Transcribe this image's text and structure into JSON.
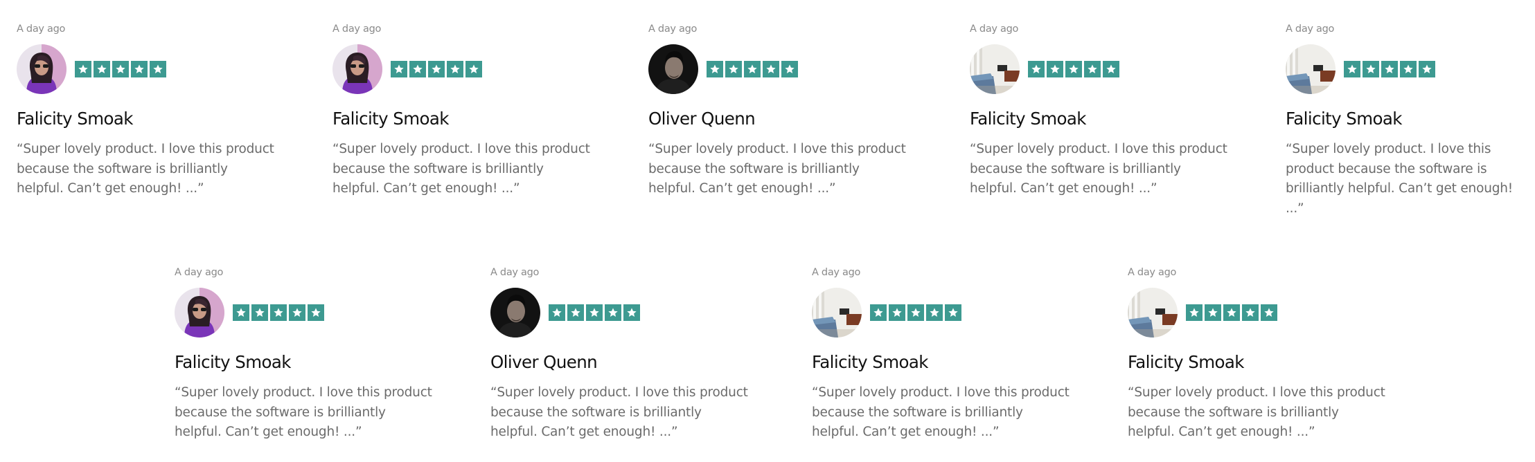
{
  "reviews": [
    {
      "time": "A day ago",
      "name": "Falicity Smoak",
      "avatar": "woman-purple-avatar",
      "rating": 5,
      "quote": "“Super lovely product. I love this product because the software is brilliantly helpful. Can’t get enough! ...”"
    },
    {
      "time": "A day ago",
      "name": "Falicity Smoak",
      "avatar": "woman-purple-avatar",
      "rating": 5,
      "quote": "“Super lovely product. I love this product because the software is brilliantly helpful. Can’t get enough! ...”"
    },
    {
      "time": "A day ago",
      "name": "Oliver Quenn",
      "avatar": "man-dark-avatar",
      "rating": 5,
      "quote": "“Super lovely product. I love this product because the software is brilliantly helpful. Can’t get enough! ...”"
    },
    {
      "time": "A day ago",
      "name": "Falicity Smoak",
      "avatar": "room-interior-avatar",
      "rating": 5,
      "quote": "“Super lovely product. I love this product because the software is brilliantly helpful. Can’t get enough! ...”"
    },
    {
      "time": "A day ago",
      "name": "Falicity Smoak",
      "avatar": "room-interior-avatar",
      "rating": 5,
      "quote": "“Super lovely product. I love this product because the software is brilliantly helpful. Can’t get enough! ...”"
    },
    {
      "time": "A day ago",
      "name": "Falicity Smoak",
      "avatar": "woman-purple-avatar",
      "rating": 5,
      "quote": "“Super lovely product. I love this product because the software is brilliantly helpful. Can’t get enough! ...”"
    },
    {
      "time": "A day ago",
      "name": "Oliver Quenn",
      "avatar": "man-dark-avatar",
      "rating": 5,
      "quote": "“Super lovely product. I love this product because the software is brilliantly helpful. Can’t get enough! ...”"
    },
    {
      "time": "A day ago",
      "name": "Falicity Smoak",
      "avatar": "room-interior-avatar",
      "rating": 5,
      "quote": "“Super lovely product. I love this product because the software is brilliantly helpful. Can’t get enough! ...”"
    },
    {
      "time": "A day ago",
      "name": "Falicity Smoak",
      "avatar": "room-interior-avatar",
      "rating": 5,
      "quote": "“Super lovely product. I love this product because the software is brilliantly helpful. Can’t get enough! ...”"
    }
  ],
  "colors": {
    "star_bg": "#3d9a91",
    "name": "#111111",
    "quote": "#6b6b6b",
    "time": "#8a8a8a"
  }
}
